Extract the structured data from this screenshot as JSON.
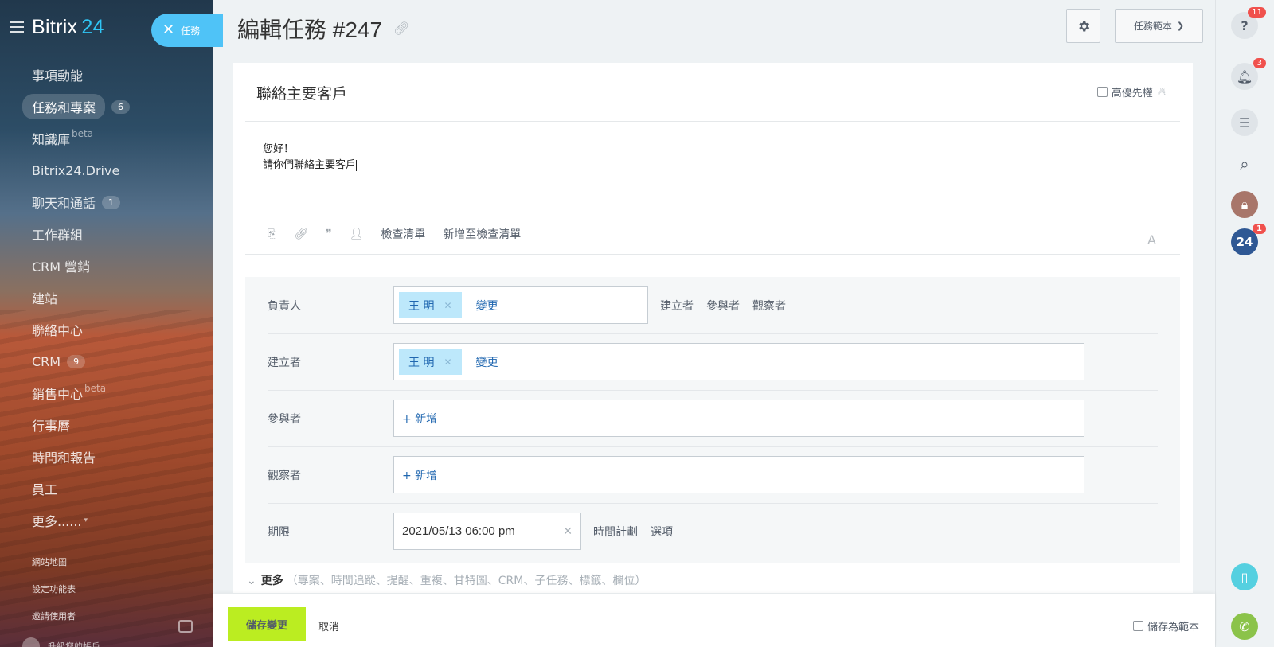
{
  "app": {
    "logo_name": "Bitrix",
    "logo_num": "24"
  },
  "tasks_pill": {
    "label": "任務"
  },
  "sidebar": {
    "items": [
      {
        "label": "事項動能"
      },
      {
        "label": "任務和專案",
        "counter": "6"
      },
      {
        "label": "知識庫",
        "sup": "beta"
      },
      {
        "label": "Bitrix24.Drive"
      },
      {
        "label": "聊天和通話",
        "counter": "1"
      },
      {
        "label": "工作群組"
      },
      {
        "label": "CRM 營銷"
      },
      {
        "label": "建站"
      },
      {
        "label": "聯絡中心"
      },
      {
        "label": "CRM",
        "counter": "9"
      },
      {
        "label": "銷售中心",
        "sup": "beta"
      },
      {
        "label": "行事曆"
      },
      {
        "label": "時間和報告"
      },
      {
        "label": "員工"
      },
      {
        "label": "更多......"
      }
    ],
    "sitemap": "網站地圖",
    "config_menu": "設定功能表",
    "invite": "邀請使用者",
    "upgrade": "升級您的帳戶"
  },
  "header": {
    "title": "編輯任務 #247",
    "template_label": "任務範本"
  },
  "task": {
    "title": "聯絡主要客戶",
    "priority_label": "高優先權",
    "description_line1": "您好！",
    "description_line2": "請你們聯絡主要客戶",
    "toolbar": {
      "checklist": "檢查清單",
      "add_checklist": "新增至檢查清單",
      "font": "A"
    }
  },
  "fields": {
    "responsible": {
      "label": "負責人",
      "user": "王 明",
      "change": "變更",
      "links": [
        "建立者",
        "參與者",
        "觀察者"
      ]
    },
    "creator": {
      "label": "建立者",
      "user": "王 明",
      "change": "變更"
    },
    "participants": {
      "label": "參與者",
      "add": "+ 新增"
    },
    "observers": {
      "label": "觀察者",
      "add": "+ 新增"
    },
    "deadline": {
      "label": "期限",
      "value": "2021/05/13 06:00 pm",
      "time_plan": "時間計劃",
      "options": "選項"
    }
  },
  "more": {
    "label": "更多",
    "hint": "（專案、時間追蹤、提醒、重複、甘特圖、CRM、子任務、標籤、欄位）"
  },
  "footer": {
    "save": "儲存變更",
    "cancel": "取消",
    "save_as_template": "儲存為範本"
  },
  "rail": {
    "help_badge": "11",
    "notify_badge": "3",
    "b24_label": "24",
    "b24_badge": "1"
  },
  "colors": {
    "accent_green": "#bbed21",
    "chip_blue": "#bde8fb",
    "link_blue": "#2067b0",
    "badge_red": "#f0514d",
    "brand_cyan": "#2fc6f6"
  }
}
